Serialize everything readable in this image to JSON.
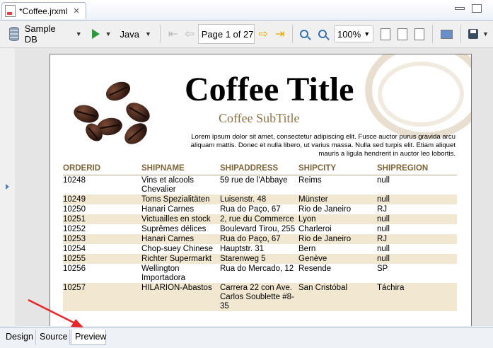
{
  "editor": {
    "tab_title": "*Coffee.jrxml",
    "close_glyph": "✕"
  },
  "toolbar": {
    "datasource": "Sample DB",
    "language": "Java",
    "page_indicator": "Page 1 of 27",
    "zoom": "100%"
  },
  "report": {
    "title": "Coffee Title",
    "subtitle": "Coffee SubTitle",
    "description": "Lorem ipsum dolor sit amet, consectetur adipiscing elit. Fusce auctor purus gravida arcu aliquam mattis. Donec et nulla libero, ut varius massa. Nulla sed turpis elit. Etiam aliquet mauris a ligula hendrerit in auctor leo lobortis.",
    "columns": [
      "ORDERID",
      "SHIPNAME",
      "SHIPADDRESS",
      "SHIPCITY",
      "SHIPREGION"
    ],
    "rows": [
      [
        "10248",
        "Vins et alcools Chevalier",
        "59 rue de l'Abbaye",
        "Reims",
        "null"
      ],
      [
        "10249",
        "Toms Spezialitäten",
        "Luisenstr. 48",
        "Münster",
        "null"
      ],
      [
        "10250",
        "Hanari Carnes",
        "Rua do Paço, 67",
        "Rio de Janeiro",
        "RJ"
      ],
      [
        "10251",
        "Victuailles en stock",
        "2, rue du Commerce",
        "Lyon",
        "null"
      ],
      [
        "10252",
        "Suprêmes délices",
        "Boulevard Tirou, 255",
        "Charleroi",
        "null"
      ],
      [
        "10253",
        "Hanari Carnes",
        "Rua do Paço, 67",
        "Rio de Janeiro",
        "RJ"
      ],
      [
        "10254",
        "Chop-suey Chinese",
        "Hauptstr. 31",
        "Bern",
        "null"
      ],
      [
        "10255",
        "Richter Supermarkt",
        "Starenweg 5",
        "Genève",
        "null"
      ],
      [
        "10256",
        "Wellington Importadora",
        "Rua do Mercado, 12",
        "Resende",
        "SP"
      ],
      [
        "10257",
        "HILARION-Abastos",
        "Carrera 22 con Ave. Carlos Soublette #8-35",
        "San Cristóbal",
        "Táchira"
      ]
    ]
  },
  "bottom_tabs": [
    {
      "label": "Design"
    },
    {
      "label": "Source"
    },
    {
      "label": "Preview"
    }
  ],
  "colors": {
    "accent": "#8b7446",
    "header_text": "#7b6439",
    "row_alt": "#f2e8d2",
    "annotation_arrow": "#e8262a"
  },
  "icons": [
    "file-icon",
    "database-icon",
    "run-icon",
    "first-page-icon",
    "previous-page-icon",
    "next-page-icon",
    "last-page-icon",
    "zoom-in-icon",
    "zoom-out-icon",
    "fit-page-icon",
    "save-icon"
  ]
}
